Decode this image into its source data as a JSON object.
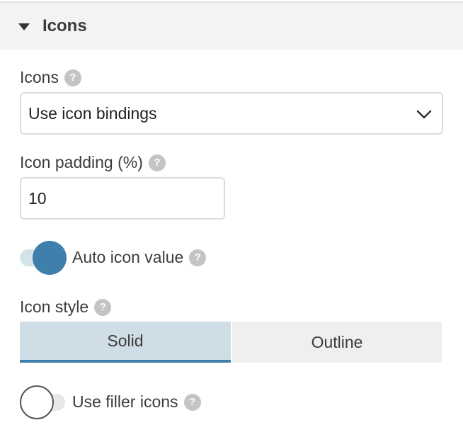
{
  "section": {
    "title": "Icons"
  },
  "icons_field": {
    "label": "Icons",
    "selected": "Use icon bindings"
  },
  "padding_field": {
    "label": "Icon padding (%)",
    "value": "10"
  },
  "auto_icon_value": {
    "label": "Auto icon value",
    "enabled": true
  },
  "icon_style": {
    "label": "Icon style",
    "options": [
      "Solid",
      "Outline"
    ],
    "selected": "Solid"
  },
  "filler_icons": {
    "label": "Use filler icons",
    "enabled": false
  },
  "help_glyph": "?",
  "colors": {
    "accent": "#3f7fab",
    "accent_light": "#cfdde6",
    "header_bg": "#f3f3f3"
  }
}
